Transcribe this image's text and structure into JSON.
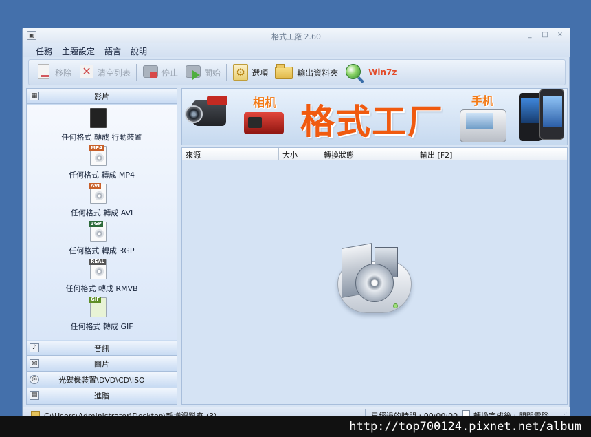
{
  "window": {
    "title": "格式工廠 2.60",
    "controls": [
      "_",
      "□",
      "×"
    ]
  },
  "menu": [
    "任務",
    "主題設定",
    "語言",
    "說明"
  ],
  "toolbar": {
    "remove": "移除",
    "clear": "清空列表",
    "stop": "停止",
    "start": "開始",
    "options": "選項",
    "output_folder": "輸出資料夾",
    "win7z": "Win7z"
  },
  "sidebar": {
    "video": "影片",
    "video_items": [
      {
        "tag": "",
        "label": "任何格式 轉成 行動裝置"
      },
      {
        "tag": "MP4",
        "label": "任何格式 轉成 MP4"
      },
      {
        "tag": "AVI",
        "label": "任何格式 轉成 AVI"
      },
      {
        "tag": "3GP",
        "label": "任何格式 轉成 3GP"
      },
      {
        "tag": "REAL",
        "label": "任何格式 轉成 RMVB"
      },
      {
        "tag": "GIF",
        "label": "任何格式 轉成 GIF"
      }
    ],
    "audio": "音訊",
    "image": "圖片",
    "rom": "光碟機裝置\\DVD\\CD\\ISO",
    "advanced": "進階"
  },
  "banner": {
    "camera": "相机",
    "title": "格式工厂",
    "phone": "手机"
  },
  "table": {
    "headers": [
      "來源",
      "大小",
      "轉換狀態",
      "輸出 [F2]"
    ]
  },
  "status": {
    "path": "C:\\Users\\Administrator\\Desktop\\新增資料夾 (3)",
    "elapsed": "已經過的時間 : 00:00:00",
    "after_convert": "轉換完成後 : 關閉電腦"
  },
  "watermark": "http://top700124.pixnet.net/album"
}
